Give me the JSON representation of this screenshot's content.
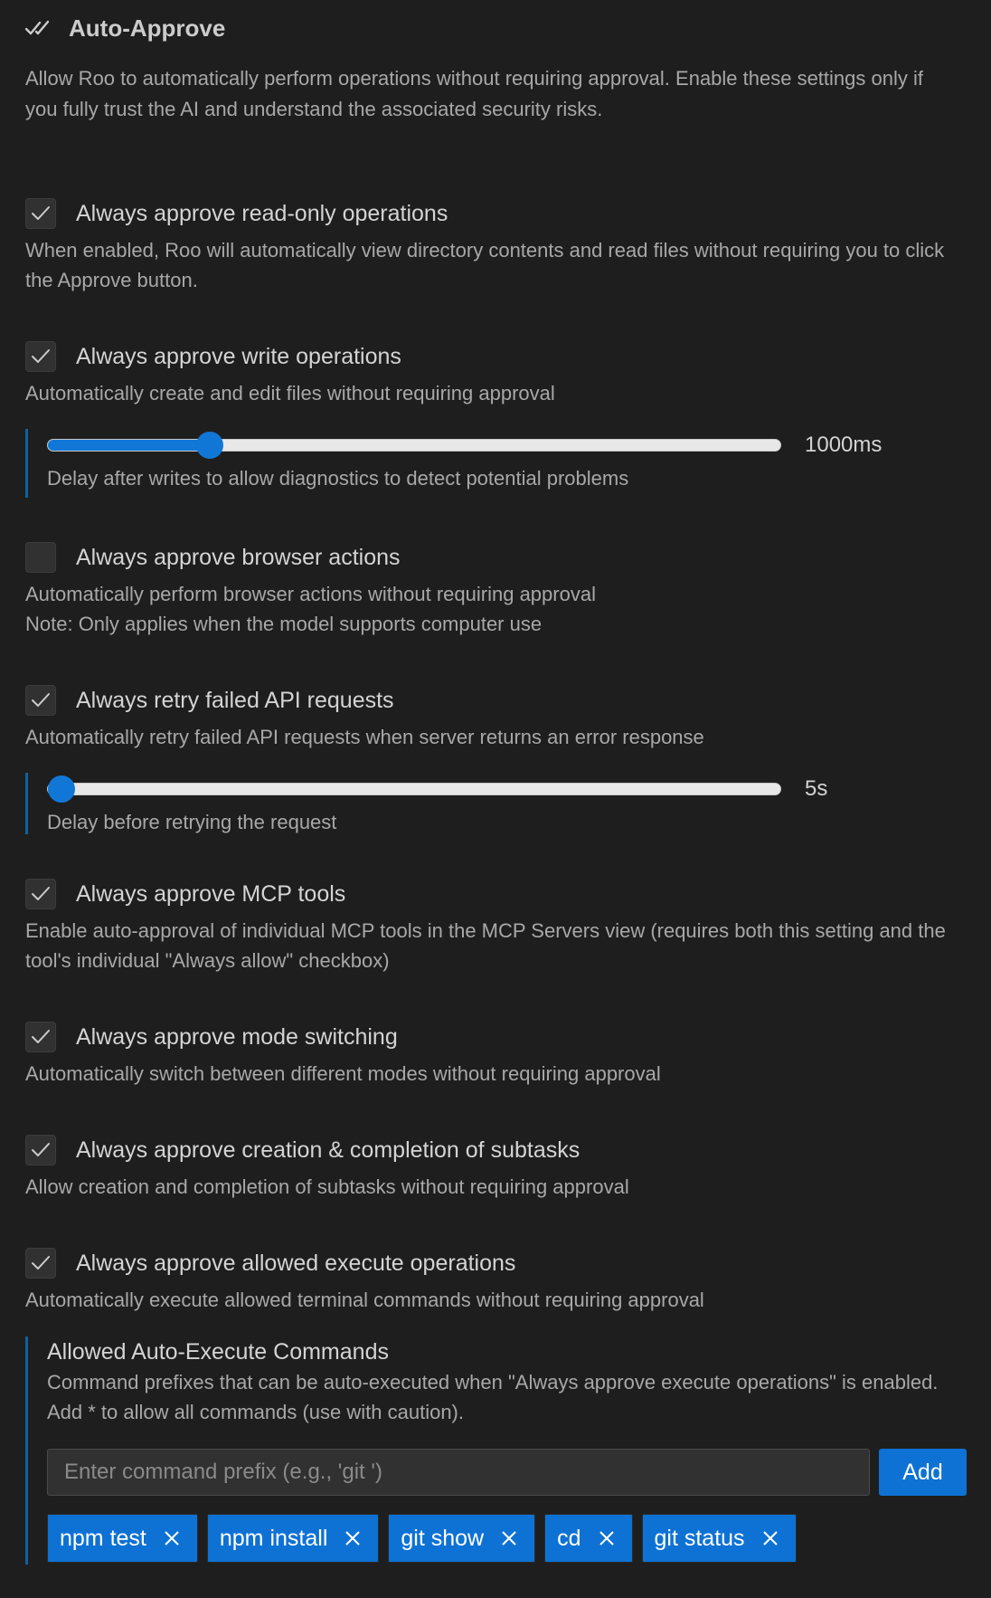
{
  "header": {
    "icon": "double-check-icon",
    "title": "Auto-Approve"
  },
  "intro": "Allow Roo to automatically perform operations without requiring approval. Enable these settings only if you fully trust the AI and understand the associated security risks.",
  "settings": [
    {
      "label": "Always approve read-only operations",
      "checked": true,
      "description": "When enabled, Roo will automatically view directory contents and read files without requiring you to click the Approve button."
    },
    {
      "label": "Always approve write operations",
      "checked": true,
      "description": "Automatically create and edit files without requiring approval"
    },
    {
      "label": "Always approve browser actions",
      "checked": false,
      "description": "Automatically perform browser actions without requiring approval",
      "note": "Note: Only applies when the model supports computer use"
    },
    {
      "label": "Always retry failed API requests",
      "checked": true,
      "description": "Automatically retry failed API requests when server returns an error response"
    },
    {
      "label": "Always approve MCP tools",
      "checked": true,
      "description": "Enable auto-approval of individual MCP tools in the MCP Servers view (requires both this setting and the tool's individual \"Always allow\" checkbox)"
    },
    {
      "label": "Always approve mode switching",
      "checked": true,
      "description": "Automatically switch between different modes without requiring approval"
    },
    {
      "label": "Always approve creation & completion of subtasks",
      "checked": true,
      "description": "Allow creation and completion of subtasks without requiring approval"
    },
    {
      "label": "Always approve allowed execute operations",
      "checked": true,
      "description": "Automatically execute allowed terminal commands without requiring approval"
    }
  ],
  "write_delay": {
    "value_label": "1000ms",
    "fraction": 0.21,
    "description": "Delay after writes to allow diagnostics to detect potential problems"
  },
  "retry_delay": {
    "value_label": "5s",
    "fraction": 0.0,
    "description": "Delay before retrying the request"
  },
  "allowed_commands": {
    "title": "Allowed Auto-Execute Commands",
    "description": "Command prefixes that can be auto-executed when \"Always approve execute operations\" is enabled. Add * to allow all commands (use with caution).",
    "input_placeholder": "Enter command prefix (e.g., 'git ')",
    "input_value": "",
    "add_label": "Add",
    "commands": [
      "npm test",
      "npm install",
      "git show",
      "cd",
      "git status"
    ]
  },
  "colors": {
    "background": "#1e1e1e",
    "accent": "#0e72d4",
    "slider_fill": "#1177d6",
    "border_accent": "#0e639c"
  }
}
